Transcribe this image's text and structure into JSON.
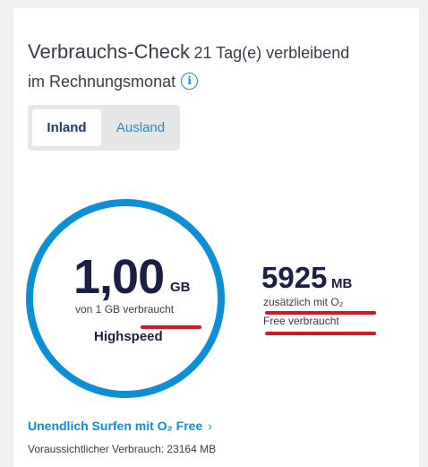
{
  "usage_check": {
    "title": "Verbrauchs-Check",
    "remaining_line_1": "21 Tag(e) verbleibend",
    "remaining_line_2": "im Rechnungsmonat",
    "info_icon": "info-icon"
  },
  "tabs": [
    {
      "label": "Inland",
      "active": true
    },
    {
      "label": "Ausland",
      "active": false
    }
  ],
  "main_usage": {
    "value": "1,00",
    "unit": "GB",
    "of_prefix": "von 1 GB",
    "used_word": "verbraucht",
    "tier": "Highspeed"
  },
  "extra_usage": {
    "value": "5925",
    "unit": "MB",
    "line_1": "zusätzlich mit O₂",
    "line_2": "Free verbraucht"
  },
  "unlimited_link": {
    "label": "Unendlich Surfen mit O₂ Free",
    "chevron": "›"
  },
  "forecast": {
    "text": "Voraussichtlicher Verbrauch: 23164 MB"
  },
  "colors": {
    "accent": "#0b8fd6",
    "navy": "#1b1f44",
    "highlight_red": "#d2192b"
  }
}
